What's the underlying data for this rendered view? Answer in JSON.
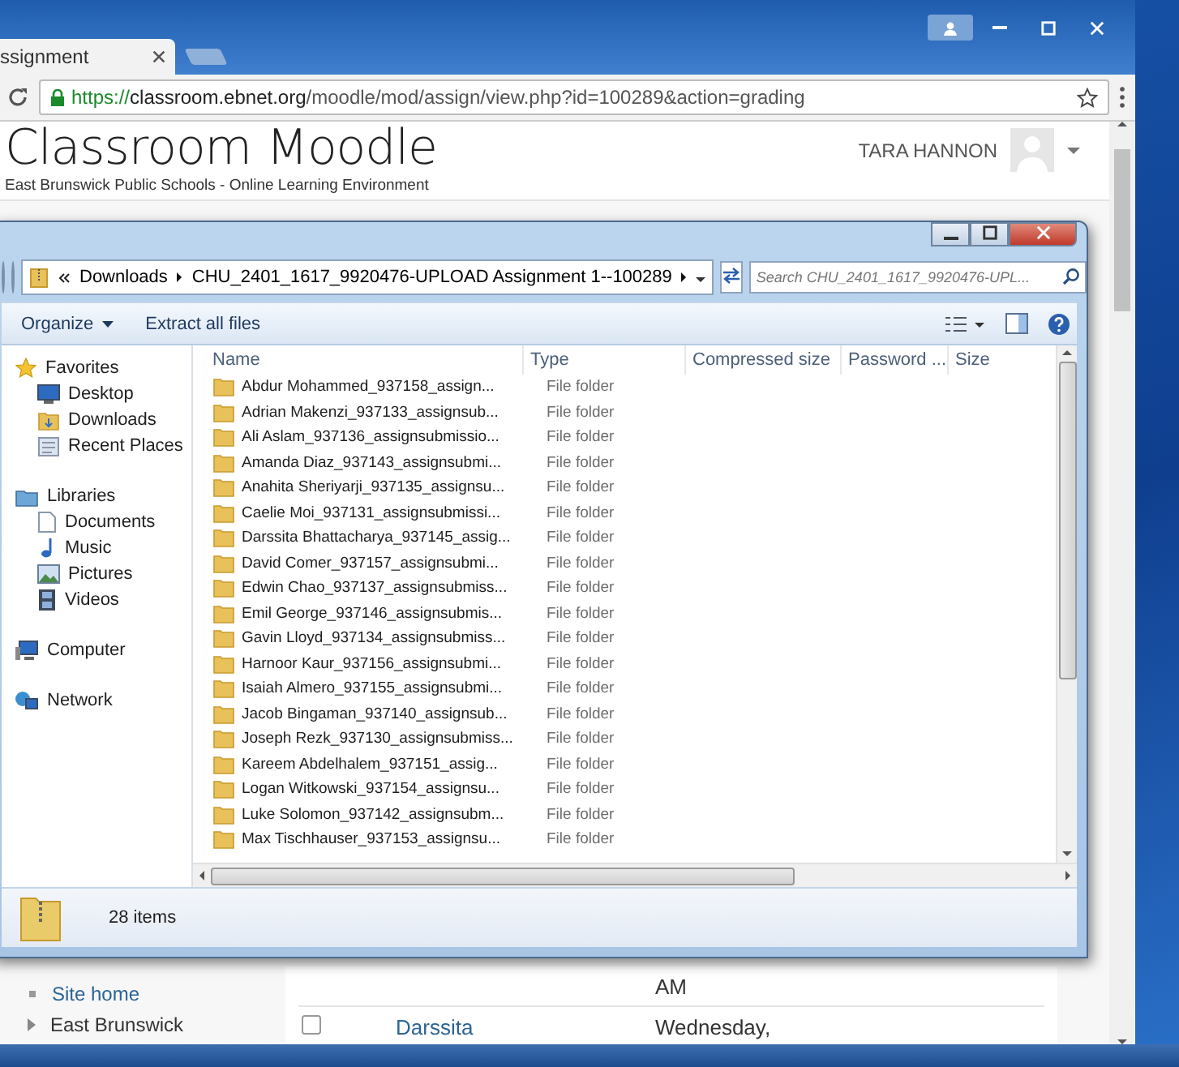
{
  "browser": {
    "tab_title": "ssignment",
    "url_scheme": "https://",
    "url_host": "classroom.ebnet.org",
    "url_path": "/moodle/mod/assign/view.php?id=100289&action=grading"
  },
  "page": {
    "site_title": "Classroom Moodle",
    "site_subtitle": "East Brunswick Public Schools - Online Learning Environment",
    "user_name": "TARA HANNON",
    "nav_items": [
      {
        "label": "Site home",
        "kind": "bullet"
      },
      {
        "label": "East Brunswick",
        "kind": "expandable"
      }
    ],
    "grading_rows": [
      {
        "date": "AM"
      },
      {
        "name": "Darssita",
        "date": "Wednesday,",
        "checked": false
      }
    ]
  },
  "explorer": {
    "path": [
      "Downloads",
      "CHU_2401_1617_9920476-UPLOAD Assignment 1--100289"
    ],
    "search_placeholder": "Search CHU_2401_1617_9920476-UPL...",
    "toolbar": [
      "Organize",
      "Extract all files"
    ],
    "nav": [
      {
        "label": "Favorites",
        "children": [
          {
            "label": "Desktop"
          },
          {
            "label": "Downloads"
          },
          {
            "label": "Recent Places"
          }
        ]
      },
      {
        "label": "Libraries",
        "children": [
          {
            "label": "Documents"
          },
          {
            "label": "Music"
          },
          {
            "label": "Pictures"
          },
          {
            "label": "Videos"
          }
        ]
      },
      {
        "label": "Computer"
      },
      {
        "label": "Network"
      }
    ],
    "columns": [
      "Name",
      "Type",
      "Compressed size",
      "Password ...",
      "Size"
    ],
    "rows": [
      {
        "name": "Abdur Mohammed_937158_assign...",
        "type": "File folder"
      },
      {
        "name": "Adrian Makenzi_937133_assignsub...",
        "type": "File folder"
      },
      {
        "name": "Ali Aslam_937136_assignsubmissio...",
        "type": "File folder"
      },
      {
        "name": "Amanda Diaz_937143_assignsubmi...",
        "type": "File folder"
      },
      {
        "name": "Anahita Sheriyarji_937135_assignsu...",
        "type": "File folder"
      },
      {
        "name": "Caelie Moi_937131_assignsubmissi...",
        "type": "File folder"
      },
      {
        "name": "Darssita Bhattacharya_937145_assig...",
        "type": "File folder"
      },
      {
        "name": "David Comer_937157_assignsubmi...",
        "type": "File folder"
      },
      {
        "name": "Edwin Chao_937137_assignsubmiss...",
        "type": "File folder"
      },
      {
        "name": "Emil George_937146_assignsubmis...",
        "type": "File folder"
      },
      {
        "name": "Gavin Lloyd_937134_assignsubmiss...",
        "type": "File folder"
      },
      {
        "name": "Harnoor Kaur_937156_assignsubmi...",
        "type": "File folder"
      },
      {
        "name": "Isaiah Almero_937155_assignsubmi...",
        "type": "File folder"
      },
      {
        "name": "Jacob Bingaman_937140_assignsub...",
        "type": "File folder"
      },
      {
        "name": "Joseph Rezk_937130_assignsubmiss...",
        "type": "File folder"
      },
      {
        "name": "Kareem Abdelhalem_937151_assig...",
        "type": "File folder"
      },
      {
        "name": "Logan Witkowski_937154_assignsu...",
        "type": "File folder"
      },
      {
        "name": "Luke Solomon_937142_assignsubm...",
        "type": "File folder"
      },
      {
        "name": "Max Tischhauser_937153_assignsu...",
        "type": "File folder"
      }
    ],
    "status": "28 items"
  }
}
